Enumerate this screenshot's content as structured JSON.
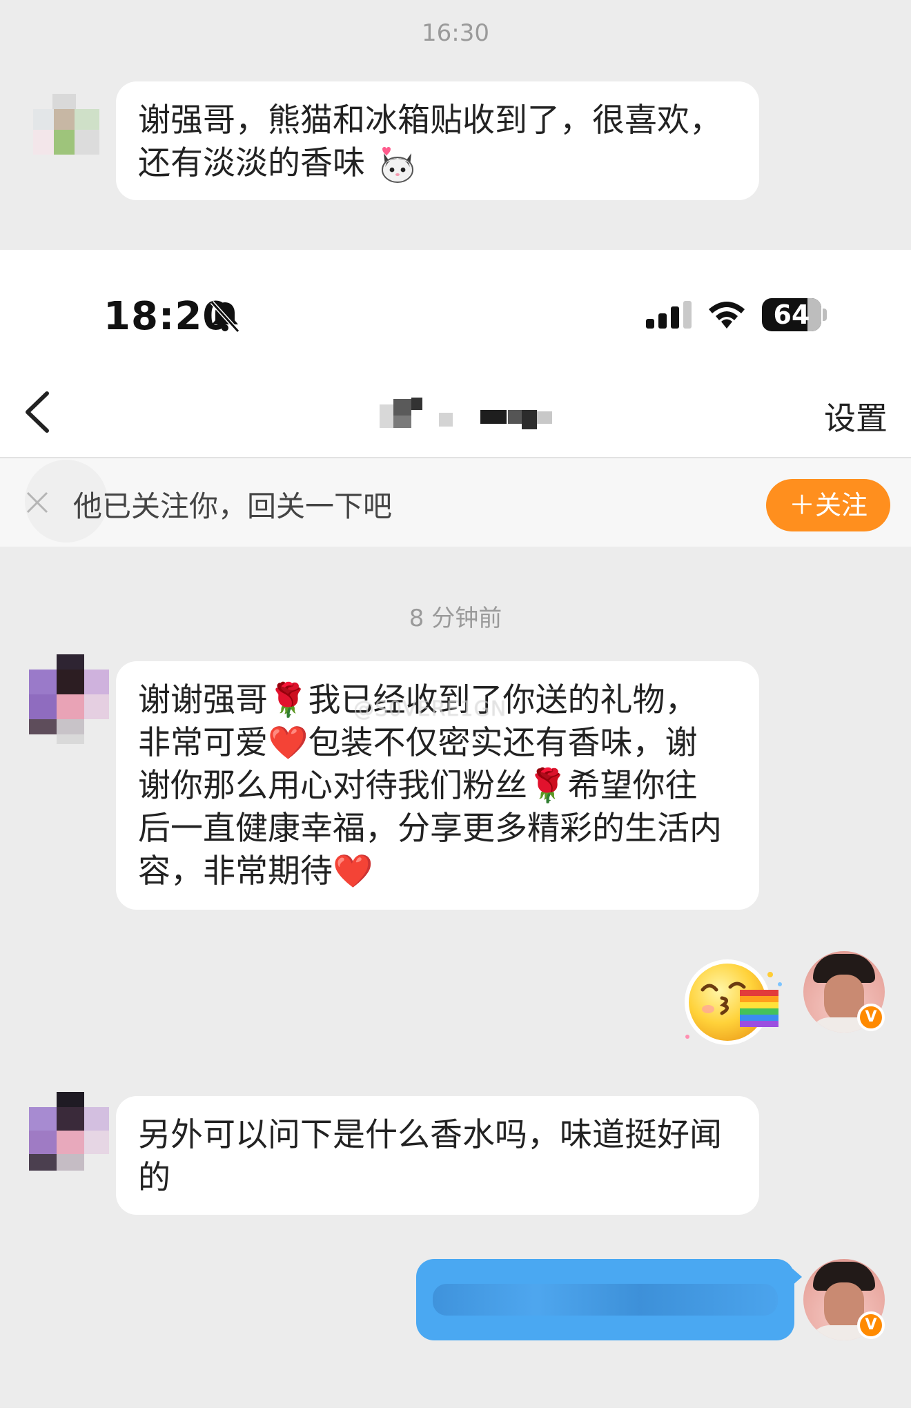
{
  "top_chat": {
    "timestamp": "16:30",
    "message_line1": "谢强哥，熊猫和冰箱贴收到了，很喜欢，",
    "message_line2": "还有淡淡的香味",
    "message_emoji": "cat-face-emoji"
  },
  "status_bar": {
    "time": "18:20",
    "battery": "64"
  },
  "nav": {
    "settings_label": "设置"
  },
  "follow_bar": {
    "prompt": "他已关注你，回关一下吧",
    "follow_button": "＋关注"
  },
  "chat": {
    "timestamp": "8 分钟前",
    "watermark": "@S0VERE1GN",
    "messages": [
      {
        "sender": "other",
        "lines": [
          "谢谢强哥🌹我已经收到了你送的礼物，",
          "非常可爱❤️包装不仅密实还有香味，谢",
          "谢你那么用心对待我们粉丝🌹希望你往",
          "后一直健康幸福，分享更多精彩的生活内",
          "容，非常期待❤️"
        ]
      },
      {
        "sender": "me",
        "type": "sticker",
        "sticker": "kissing-face-rainbow-emoji"
      },
      {
        "sender": "other",
        "lines": [
          "另外可以问下是什么香水吗，味道挺好闻",
          "的"
        ]
      },
      {
        "sender": "me",
        "type": "text",
        "content": ""
      }
    ]
  },
  "colors": {
    "background": "#ececec",
    "bubble_other": "#ffffff",
    "bubble_me": "#4aa8f2",
    "follow_button": "#ff8f1e",
    "verified_badge": "#ff8a00"
  }
}
